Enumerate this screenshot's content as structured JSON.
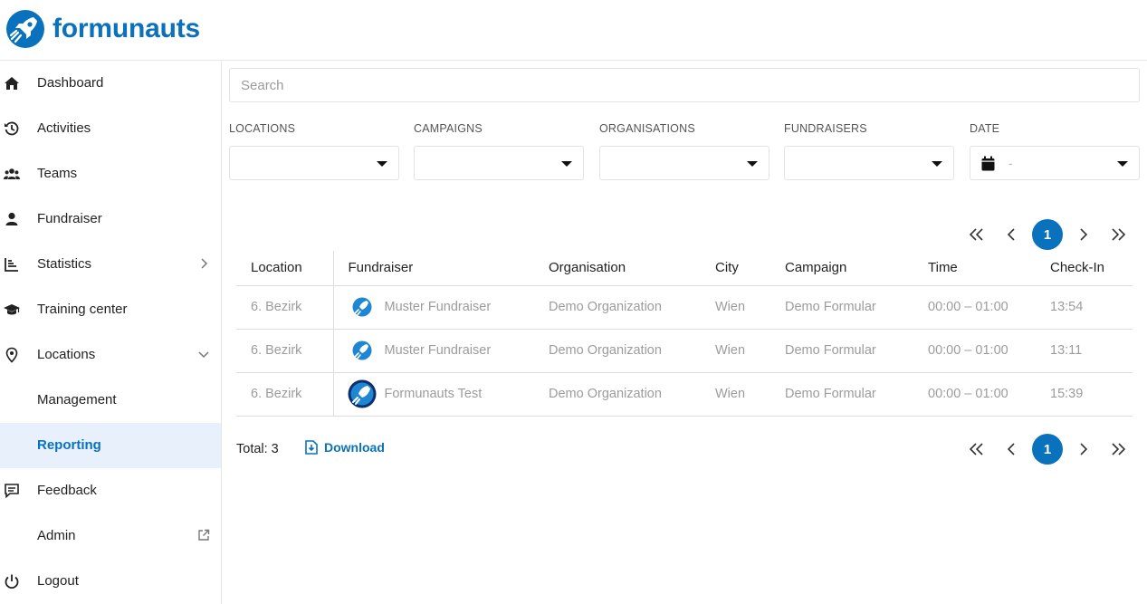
{
  "brand": {
    "name": "formunauts"
  },
  "sidebar": {
    "items": [
      {
        "label": "Dashboard",
        "icon": "home-icon"
      },
      {
        "label": "Activities",
        "icon": "history-icon"
      },
      {
        "label": "Teams",
        "icon": "users-icon"
      },
      {
        "label": "Fundraiser",
        "icon": "user-icon"
      },
      {
        "label": "Statistics",
        "icon": "chart-icon"
      },
      {
        "label": "Training center",
        "icon": "graduation-cap-icon"
      },
      {
        "label": "Locations",
        "icon": "map-pin-icon"
      },
      {
        "label": "Management"
      },
      {
        "label": "Reporting",
        "active": true
      },
      {
        "label": "Feedback",
        "icon": "feedback-icon"
      },
      {
        "label": "Admin",
        "icon": "external-link-icon"
      },
      {
        "label": "Logout",
        "icon": "power-icon"
      }
    ]
  },
  "search": {
    "placeholder": "Search"
  },
  "filters": {
    "locations": {
      "label": "LOCATIONS",
      "value": ""
    },
    "campaigns": {
      "label": "CAMPAIGNS",
      "value": ""
    },
    "organisations": {
      "label": "ORGANISATIONS",
      "value": ""
    },
    "fundraisers": {
      "label": "FUNDRAISERS",
      "value": ""
    },
    "date": {
      "label": "DATE",
      "value": "-"
    }
  },
  "pagination": {
    "current_page": "1"
  },
  "table": {
    "headers": [
      "Location",
      "Fundraiser",
      "Organisation",
      "City",
      "Campaign",
      "Time",
      "Check-In"
    ],
    "rows": [
      [
        "6. Bezirk",
        "Muster Fundraiser",
        "Demo Organization",
        "Wien",
        "Demo Formular",
        "00:00 – 01:00",
        "13:54"
      ],
      [
        "6. Bezirk",
        "Muster Fundraiser",
        "Demo Organization",
        "Wien",
        "Demo Formular",
        "00:00 – 01:00",
        "13:11"
      ],
      [
        "6. Bezirk",
        "Formunauts Test",
        "Demo Organization",
        "Wien",
        "Demo Formular",
        "00:00 – 01:00",
        "15:39"
      ]
    ]
  },
  "footer": {
    "total": "Total: 3",
    "download_label": "Download"
  },
  "colors": {
    "accent": "#0a72bd",
    "active_bg": "#e8f1fb"
  }
}
